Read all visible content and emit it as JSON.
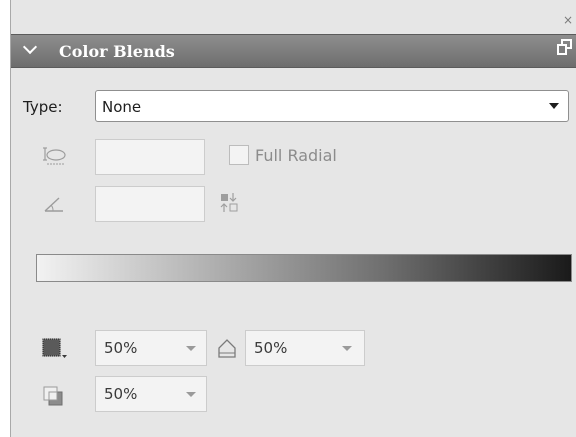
{
  "panel": {
    "title": "Color Blends",
    "icons": {
      "collapse": "chevron-down-icon",
      "float": "float-panel-icon",
      "close": "close-icon"
    }
  },
  "type_row": {
    "label": "Type:",
    "value": "None"
  },
  "full_radial": {
    "label": "Full Radial",
    "checked": false
  },
  "opacity": {
    "fill_opacity": "50%",
    "stroke_opacity": "50%",
    "third_opacity": "50%"
  },
  "colors": {
    "title_bar": "#7d7d7d",
    "panel_bg": "#e6e6e6",
    "gradient_start": "#f2f2f2",
    "gradient_end": "#1a1a1a"
  }
}
